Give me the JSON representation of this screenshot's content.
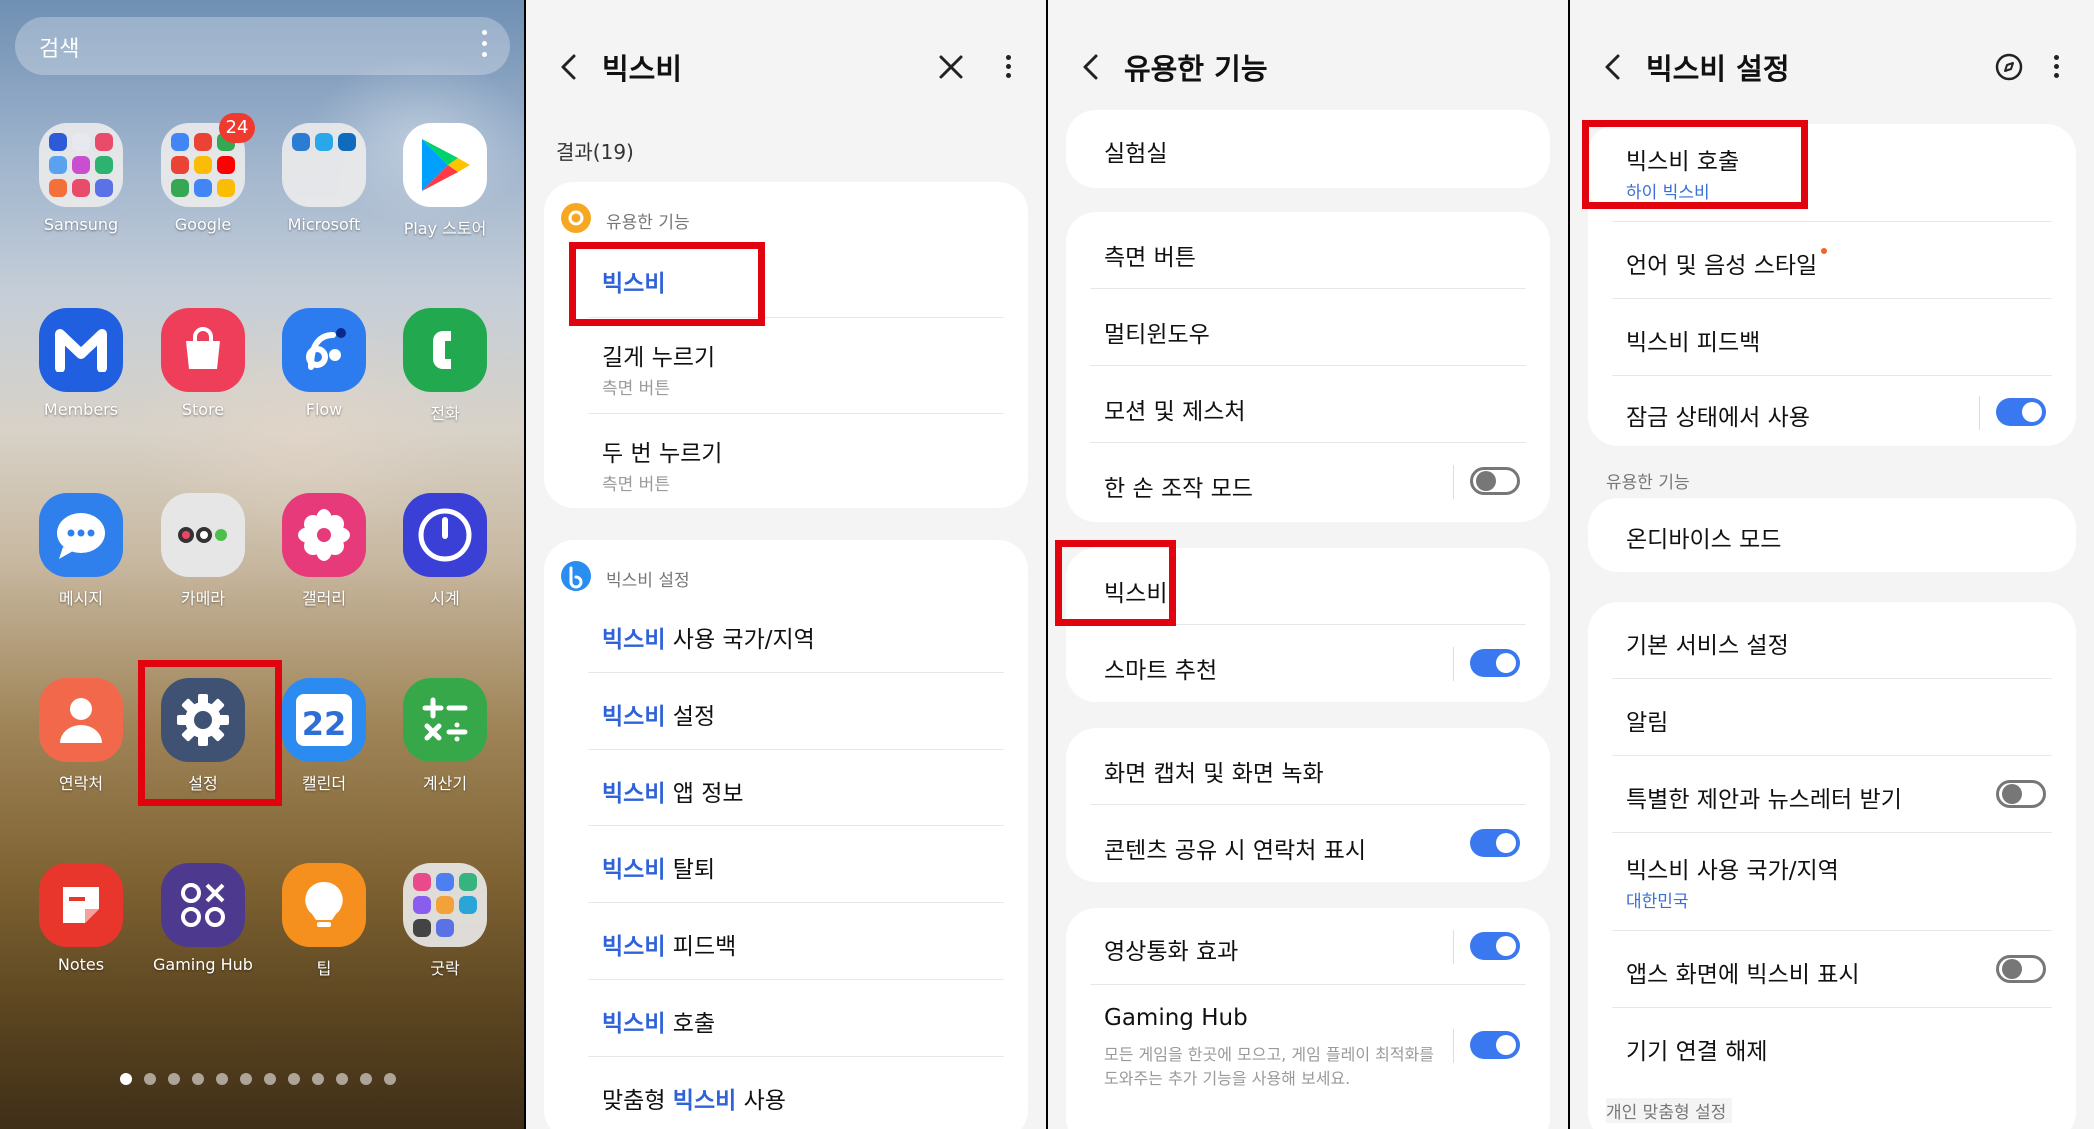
{
  "home": {
    "search_placeholder": "검색",
    "apps": [
      {
        "label": "Samsung",
        "icon": "samsung-folder-icon"
      },
      {
        "label": "Google",
        "icon": "google-folder-icon",
        "badge": "24"
      },
      {
        "label": "Microsoft",
        "icon": "microsoft-folder-icon"
      },
      {
        "label": "Play 스토어",
        "icon": "play-store-icon"
      },
      {
        "label": "Members",
        "icon": "members-icon"
      },
      {
        "label": "Store",
        "icon": "store-icon"
      },
      {
        "label": "Flow",
        "icon": "flow-icon"
      },
      {
        "label": "전화",
        "icon": "phone-icon"
      },
      {
        "label": "메시지",
        "icon": "messages-icon"
      },
      {
        "label": "카메라",
        "icon": "camera-icon"
      },
      {
        "label": "갤러리",
        "icon": "gallery-icon"
      },
      {
        "label": "시계",
        "icon": "clock-icon"
      },
      {
        "label": "연락처",
        "icon": "contacts-icon"
      },
      {
        "label": "설정",
        "icon": "settings-gear-icon"
      },
      {
        "label": "캘린더",
        "icon": "calendar-icon",
        "text": "22"
      },
      {
        "label": "계산기",
        "icon": "calculator-icon"
      },
      {
        "label": "Notes",
        "icon": "notes-icon"
      },
      {
        "label": "Gaming Hub",
        "icon": "gaming-hub-icon"
      },
      {
        "label": "팁",
        "icon": "tips-bulb-icon"
      },
      {
        "label": "굿락",
        "icon": "goodlock-folder-icon"
      }
    ],
    "page_count": 12,
    "current_page": 1
  },
  "search_panel": {
    "title": "빅스비",
    "result_count": "결과(19)",
    "group1": {
      "label": "유용한 기능",
      "items": [
        {
          "highlight": "빅스비",
          "rest": "",
          "sub": ""
        },
        {
          "highlight": "",
          "rest": "길게 누르기",
          "sub": "측면 버튼"
        },
        {
          "highlight": "",
          "rest": "두 번 누르기",
          "sub": "측면 버튼"
        }
      ]
    },
    "group2": {
      "label": "빅스비 설정",
      "items": [
        {
          "pre": "",
          "highlight": "빅스비",
          "rest": " 사용 국가/지역"
        },
        {
          "pre": "",
          "highlight": "빅스비",
          "rest": " 설정"
        },
        {
          "pre": "",
          "highlight": "빅스비",
          "rest": " 앱 정보"
        },
        {
          "pre": "",
          "highlight": "빅스비",
          "rest": " 탈퇴"
        },
        {
          "pre": "",
          "highlight": "빅스비",
          "rest": " 피드백"
        },
        {
          "pre": "",
          "highlight": "빅스비",
          "rest": " 호출"
        },
        {
          "pre": "맞춤형 ",
          "highlight": "빅스비",
          "rest": " 사용"
        }
      ]
    }
  },
  "useful_panel": {
    "title": "유용한 기능",
    "lab": "실험실",
    "group1": [
      "측면 버튼",
      "멀티윈도우",
      "모션 및 제스처",
      "한 손 조작 모드"
    ],
    "one_hand_toggle": false,
    "group2": [
      "빅스비",
      "스마트 추천"
    ],
    "smart_toggle": true,
    "group3": [
      "화면 캡처 및 화면 녹화",
      "콘텐츠 공유 시 연락처 표시"
    ],
    "share_toggle": true,
    "video_call": "영상통화 효과",
    "video_toggle": true,
    "gaming_hub": "Gaming Hub",
    "gaming_hub_desc_1": "모든 게임을 한곳에 모으고, 게임 플레이 최적화를",
    "gaming_hub_desc_2": "도와주는 추가 기능을 사용해 보세요.",
    "gaming_toggle": true
  },
  "bixby_settings": {
    "title": "빅스비 설정",
    "wake": "빅스비 호출",
    "wake_sub": "하이 빅스비",
    "language": "언어 및 음성 스타일",
    "feedback": "빅스비 피드백",
    "lock_use": "잠금 상태에서 사용",
    "lock_toggle": true,
    "section_useful": "유용한 기능",
    "on_device": "온디바이스 모드",
    "basic_service": "기본 서비스 설정",
    "notifications": "알림",
    "offers": "특별한 제안과 뉴스레터 받기",
    "offers_toggle": false,
    "country": "빅스비 사용 국가/지역",
    "country_sub": "대한민국",
    "show_on_apps": "앱스 화면에 빅스비 표시",
    "show_toggle": false,
    "disconnect": "기기 연결 해제",
    "section_personal": "개인 맞춤형 설정"
  },
  "colors": {
    "highlight_box": "#e1040e",
    "accent_blue": "#2e62d9",
    "toggle_on": "#3a78f0"
  }
}
